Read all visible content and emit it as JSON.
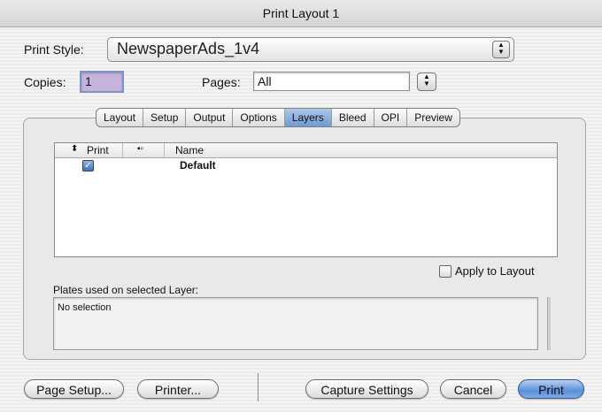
{
  "window": {
    "title": "Print Layout 1"
  },
  "print_style": {
    "label": "Print Style:",
    "value": "NewspaperAds_1v4"
  },
  "copies": {
    "label": "Copies:",
    "value": "1"
  },
  "pages": {
    "label": "Pages:",
    "value": "All"
  },
  "tabs": [
    {
      "label": "Layout"
    },
    {
      "label": "Setup"
    },
    {
      "label": "Output"
    },
    {
      "label": "Options"
    },
    {
      "label": "Layers"
    },
    {
      "label": "Bleed"
    },
    {
      "label": "OPI"
    },
    {
      "label": "Preview"
    }
  ],
  "active_tab": "Layers",
  "layers_table": {
    "columns": {
      "print": "Print",
      "name": "Name"
    },
    "rows": [
      {
        "print_checked": true,
        "name": "Default"
      }
    ]
  },
  "apply_to_layout": {
    "label": "Apply to Layout",
    "checked": false
  },
  "plates": {
    "label": "Plates used on selected Layer:",
    "value": "No selection"
  },
  "buttons": {
    "page_setup": "Page Setup...",
    "printer": "Printer...",
    "capture_settings": "Capture Settings",
    "cancel": "Cancel",
    "print": "Print"
  }
}
